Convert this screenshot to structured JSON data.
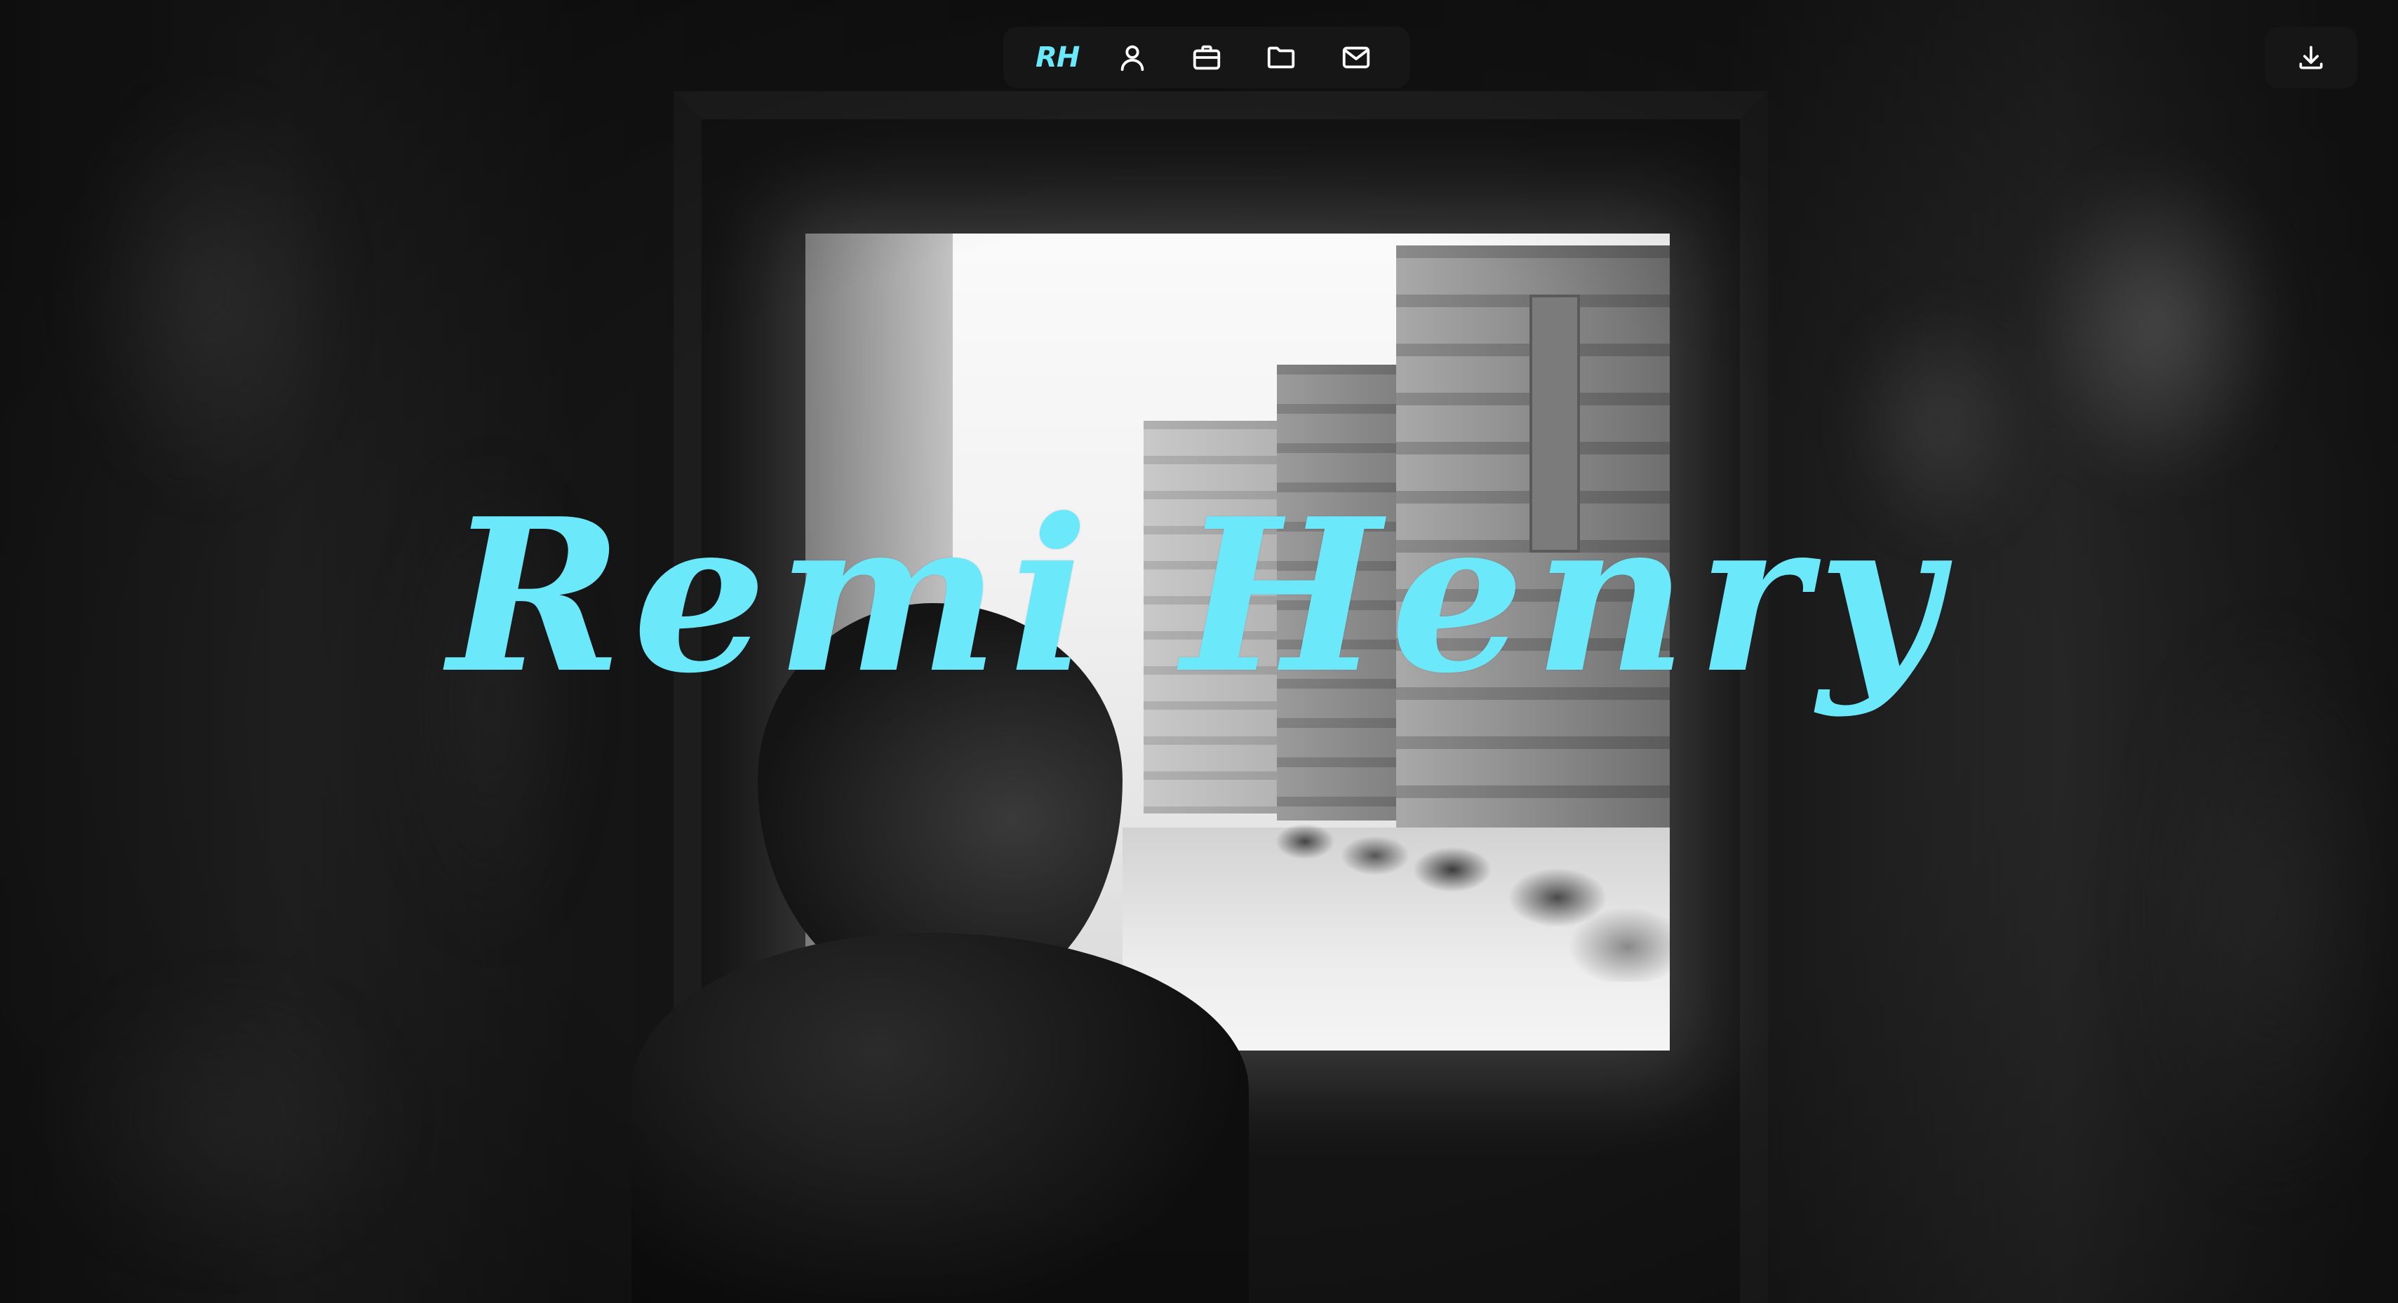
{
  "hero": {
    "title": "Remi Henry",
    "title_color": "#6ce8fb",
    "photo_style": "black-and-white"
  },
  "nav": {
    "logo_text": "RH",
    "items": [
      {
        "icon": "user-icon",
        "label": ""
      },
      {
        "icon": "briefcase-icon",
        "label": ""
      },
      {
        "icon": "folder-icon",
        "label": ""
      },
      {
        "icon": "mail-icon",
        "label": ""
      }
    ],
    "background": "#161616"
  },
  "actions": {
    "download_icon": "download-icon"
  }
}
